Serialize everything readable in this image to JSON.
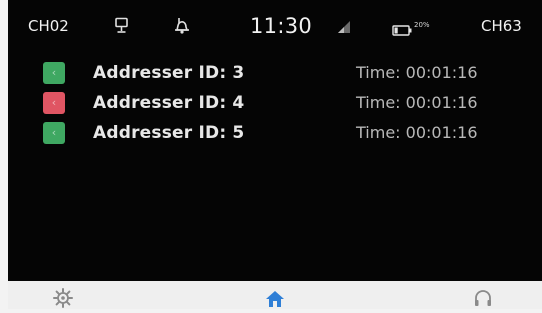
{
  "status_bar": {
    "left_channel": "CH02",
    "time": "11:30",
    "battery_percent": "20%",
    "right_channel": "CH63",
    "icons": [
      "monitor-icon",
      "bell-off-icon",
      "signal-icon",
      "battery-icon"
    ]
  },
  "alarms": [
    {
      "status_color": "#3fa862",
      "address_label": "Addresser ID: 3",
      "time_label": "Time: 00:01:16"
    },
    {
      "status_color": "#e05563",
      "address_label": "Addresser ID: 4",
      "time_label": "Time: 00:01:16"
    },
    {
      "status_color": "#3fa862",
      "address_label": "Addresser ID: 5",
      "time_label": "Time: 00:01:16"
    }
  ],
  "bottom_nav": {
    "items": [
      "settings-icon",
      "home-icon",
      "headset-icon"
    ],
    "active": "home-icon",
    "active_color": "#2f7fd6"
  },
  "colors": {
    "screen_background": "#050505",
    "text_primary": "#e8e8e8",
    "text_secondary": "#b9b9b9"
  }
}
